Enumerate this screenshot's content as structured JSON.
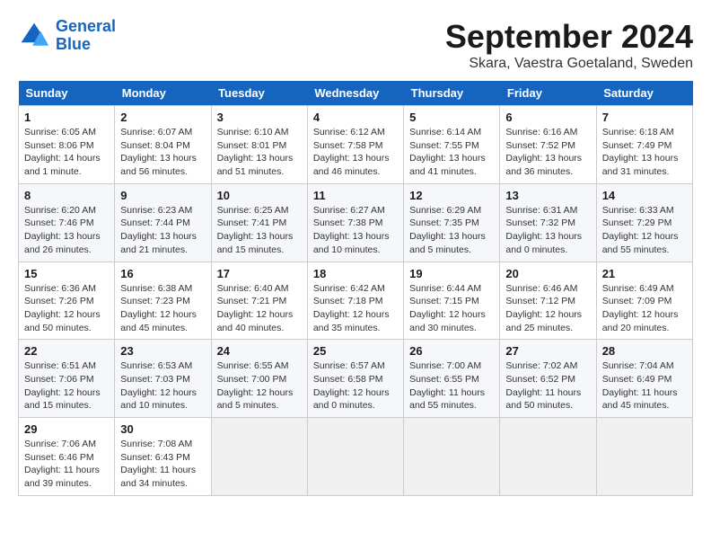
{
  "header": {
    "logo_line1": "General",
    "logo_line2": "Blue",
    "month_title": "September 2024",
    "location": "Skara, Vaestra Goetaland, Sweden"
  },
  "weekdays": [
    "Sunday",
    "Monday",
    "Tuesday",
    "Wednesday",
    "Thursday",
    "Friday",
    "Saturday"
  ],
  "weeks": [
    [
      {
        "day": "1",
        "info": "Sunrise: 6:05 AM\nSunset: 8:06 PM\nDaylight: 14 hours\nand 1 minute."
      },
      {
        "day": "2",
        "info": "Sunrise: 6:07 AM\nSunset: 8:04 PM\nDaylight: 13 hours\nand 56 minutes."
      },
      {
        "day": "3",
        "info": "Sunrise: 6:10 AM\nSunset: 8:01 PM\nDaylight: 13 hours\nand 51 minutes."
      },
      {
        "day": "4",
        "info": "Sunrise: 6:12 AM\nSunset: 7:58 PM\nDaylight: 13 hours\nand 46 minutes."
      },
      {
        "day": "5",
        "info": "Sunrise: 6:14 AM\nSunset: 7:55 PM\nDaylight: 13 hours\nand 41 minutes."
      },
      {
        "day": "6",
        "info": "Sunrise: 6:16 AM\nSunset: 7:52 PM\nDaylight: 13 hours\nand 36 minutes."
      },
      {
        "day": "7",
        "info": "Sunrise: 6:18 AM\nSunset: 7:49 PM\nDaylight: 13 hours\nand 31 minutes."
      }
    ],
    [
      {
        "day": "8",
        "info": "Sunrise: 6:20 AM\nSunset: 7:46 PM\nDaylight: 13 hours\nand 26 minutes."
      },
      {
        "day": "9",
        "info": "Sunrise: 6:23 AM\nSunset: 7:44 PM\nDaylight: 13 hours\nand 21 minutes."
      },
      {
        "day": "10",
        "info": "Sunrise: 6:25 AM\nSunset: 7:41 PM\nDaylight: 13 hours\nand 15 minutes."
      },
      {
        "day": "11",
        "info": "Sunrise: 6:27 AM\nSunset: 7:38 PM\nDaylight: 13 hours\nand 10 minutes."
      },
      {
        "day": "12",
        "info": "Sunrise: 6:29 AM\nSunset: 7:35 PM\nDaylight: 13 hours\nand 5 minutes."
      },
      {
        "day": "13",
        "info": "Sunrise: 6:31 AM\nSunset: 7:32 PM\nDaylight: 13 hours\nand 0 minutes."
      },
      {
        "day": "14",
        "info": "Sunrise: 6:33 AM\nSunset: 7:29 PM\nDaylight: 12 hours\nand 55 minutes."
      }
    ],
    [
      {
        "day": "15",
        "info": "Sunrise: 6:36 AM\nSunset: 7:26 PM\nDaylight: 12 hours\nand 50 minutes."
      },
      {
        "day": "16",
        "info": "Sunrise: 6:38 AM\nSunset: 7:23 PM\nDaylight: 12 hours\nand 45 minutes."
      },
      {
        "day": "17",
        "info": "Sunrise: 6:40 AM\nSunset: 7:21 PM\nDaylight: 12 hours\nand 40 minutes."
      },
      {
        "day": "18",
        "info": "Sunrise: 6:42 AM\nSunset: 7:18 PM\nDaylight: 12 hours\nand 35 minutes."
      },
      {
        "day": "19",
        "info": "Sunrise: 6:44 AM\nSunset: 7:15 PM\nDaylight: 12 hours\nand 30 minutes."
      },
      {
        "day": "20",
        "info": "Sunrise: 6:46 AM\nSunset: 7:12 PM\nDaylight: 12 hours\nand 25 minutes."
      },
      {
        "day": "21",
        "info": "Sunrise: 6:49 AM\nSunset: 7:09 PM\nDaylight: 12 hours\nand 20 minutes."
      }
    ],
    [
      {
        "day": "22",
        "info": "Sunrise: 6:51 AM\nSunset: 7:06 PM\nDaylight: 12 hours\nand 15 minutes."
      },
      {
        "day": "23",
        "info": "Sunrise: 6:53 AM\nSunset: 7:03 PM\nDaylight: 12 hours\nand 10 minutes."
      },
      {
        "day": "24",
        "info": "Sunrise: 6:55 AM\nSunset: 7:00 PM\nDaylight: 12 hours\nand 5 minutes."
      },
      {
        "day": "25",
        "info": "Sunrise: 6:57 AM\nSunset: 6:58 PM\nDaylight: 12 hours\nand 0 minutes."
      },
      {
        "day": "26",
        "info": "Sunrise: 7:00 AM\nSunset: 6:55 PM\nDaylight: 11 hours\nand 55 minutes."
      },
      {
        "day": "27",
        "info": "Sunrise: 7:02 AM\nSunset: 6:52 PM\nDaylight: 11 hours\nand 50 minutes."
      },
      {
        "day": "28",
        "info": "Sunrise: 7:04 AM\nSunset: 6:49 PM\nDaylight: 11 hours\nand 45 minutes."
      }
    ],
    [
      {
        "day": "29",
        "info": "Sunrise: 7:06 AM\nSunset: 6:46 PM\nDaylight: 11 hours\nand 39 minutes."
      },
      {
        "day": "30",
        "info": "Sunrise: 7:08 AM\nSunset: 6:43 PM\nDaylight: 11 hours\nand 34 minutes."
      },
      {
        "day": "",
        "info": ""
      },
      {
        "day": "",
        "info": ""
      },
      {
        "day": "",
        "info": ""
      },
      {
        "day": "",
        "info": ""
      },
      {
        "day": "",
        "info": ""
      }
    ]
  ]
}
